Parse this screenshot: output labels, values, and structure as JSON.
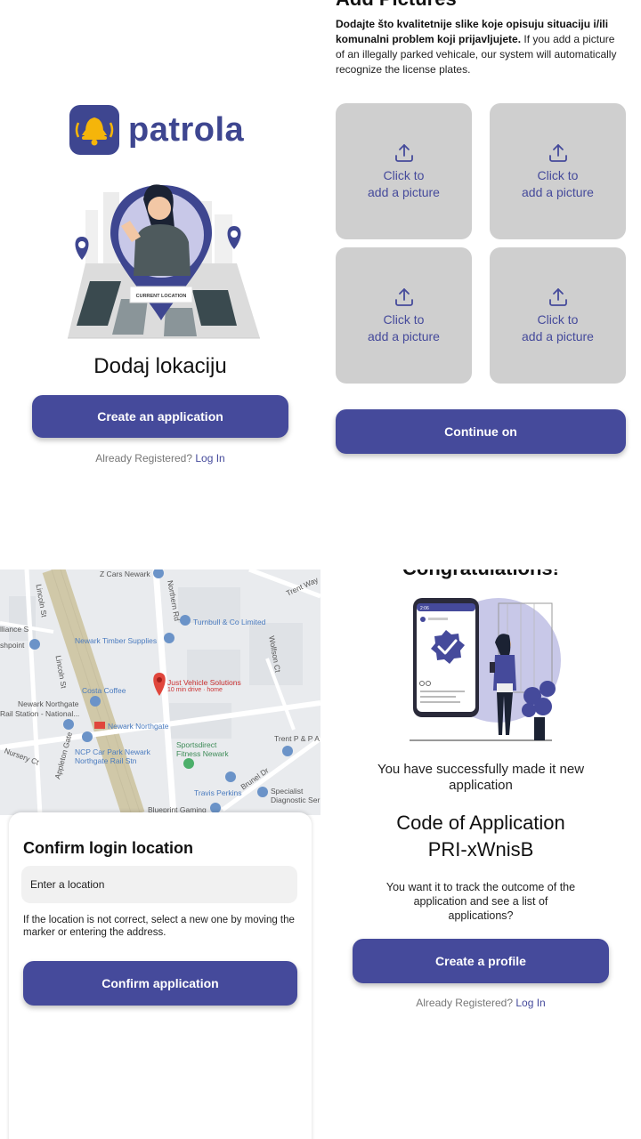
{
  "screen1": {
    "brand": "patrola",
    "illustration_label": "CURRENT LOCATION",
    "title": "Dodaj lokaciju",
    "create_button": "Create an application",
    "already_registered": "Already Registered?",
    "login_link": "Log In"
  },
  "screen2": {
    "header": "Add Pictures",
    "description_bold": "Dodajte što kvalitetnije slike koje opisuju situaciju i/ili komunalni problem koji prijavljujete.",
    "description_rest": " If you add a picture of an illegally parked vehicale, our system will automatically recognize the license plates.",
    "tiles": [
      {
        "line1": "Click to",
        "line2": "add a picture",
        "icon": "upload-icon"
      },
      {
        "line1": "Click to",
        "line2": "add a picture",
        "icon": "upload-icon"
      },
      {
        "line1": "Click to",
        "line2": "add a picture",
        "icon": "upload-icon"
      },
      {
        "line1": "Click to",
        "line2": "add a picture",
        "icon": "upload-icon"
      }
    ],
    "continue_button": "Continue on"
  },
  "screen3": {
    "map_labels": {
      "z_cars": "Z Cars Newark",
      "turnbull": "Turnbull & Co Limited",
      "timber": "Newark Timber Supplies",
      "pin_title": "Just Vehicle Solutions",
      "pin_sub": "10 min drive · home",
      "costa": "Costa Coffee",
      "northgate_station": "Newark Northgate",
      "rail_station": "Rail Station - National...",
      "newark_northgate": "Newark Northgate",
      "sportsdirect": "Sportsdirect",
      "fitness": "Fitness Newark",
      "ncp": "NCP Car Park Newark",
      "ncp2": "Northgate Rail Stn",
      "trent": "Trent P & P A",
      "travis": "Travis Perkins",
      "specialist": "Specialist",
      "diagnostic": "Diagnostic Ser",
      "blueprint": "Blueprint Gaming",
      "alliance": "lliance S",
      "shpoint": "shpoint",
      "nursery": "Nursery Ct",
      "lincoln": "Lincoln St",
      "trent_way": "Trent Way",
      "northern": "Northern Rd",
      "wolfson": "Wolfson Ct",
      "brunel": "Brunel Dr",
      "appleton": "Appleton Gate"
    },
    "sheet_title": "Confirm login location",
    "location_placeholder": "Enter a location",
    "hint": "If the location is not correct, select a new one by moving the marker or entering the address.",
    "confirm_button": "Confirm application"
  },
  "screen4": {
    "header": "Congratulations!",
    "phone_time": "2:06",
    "message": "You have successfully made it new application",
    "code_label": "Code of Application",
    "code_value": "PRI-xWnisB",
    "track": "You want it to track the outcome of the application and see a list of applications?",
    "profile_button": "Create a profile",
    "already_registered": "Already Registered?",
    "login_link": "Log In"
  },
  "colors": {
    "primary": "#454a9b",
    "logo_yellow": "#f5b50a",
    "tile_bg": "#cfcfcf",
    "illustration_purple": "#c8c8e8"
  }
}
